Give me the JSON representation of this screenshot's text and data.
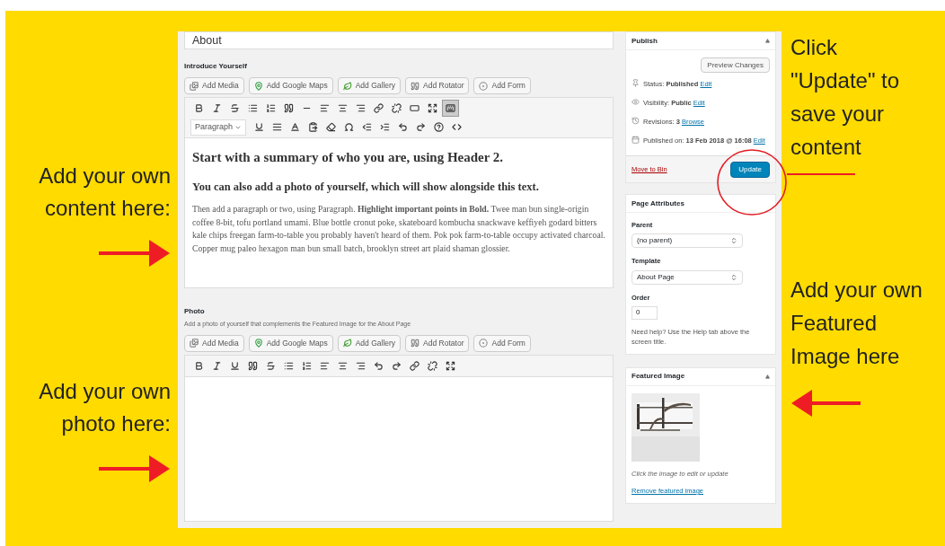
{
  "annotations_left": [
    {
      "text": "Add your own content here:"
    },
    {
      "text": "Add your own photo here:"
    }
  ],
  "annotations_right": [
    {
      "text": "Click \"Update\" to save your content",
      "kind": "line"
    },
    {
      "text": "Add your own Featured Image here",
      "kind": "arrow"
    }
  ],
  "title_field": {
    "value": "About"
  },
  "sections": [
    {
      "label": "Introduce Yourself",
      "media_buttons": [
        {
          "kind": "media",
          "label": "Add Media"
        },
        {
          "kind": "maps",
          "label": "Add Google Maps"
        },
        {
          "kind": "gallery",
          "label": "Add Gallery"
        },
        {
          "kind": "rotator",
          "label": "Add Rotator"
        },
        {
          "kind": "form",
          "label": "Add Form"
        }
      ],
      "toolbar_rows": [
        [
          {
            "kind": "bold",
            "selected": false
          },
          {
            "kind": "italic",
            "selected": false
          },
          {
            "kind": "strike",
            "selected": false
          },
          {
            "kind": "ul",
            "selected": false
          },
          {
            "kind": "ol",
            "selected": false
          },
          {
            "kind": "quote",
            "selected": false
          },
          {
            "kind": "hr",
            "selected": false
          },
          {
            "kind": "left",
            "selected": false
          },
          {
            "kind": "center",
            "selected": false
          },
          {
            "kind": "right",
            "selected": false
          },
          {
            "kind": "link",
            "selected": false
          },
          {
            "kind": "unlink",
            "selected": false
          },
          {
            "kind": "more",
            "selected": false
          },
          {
            "kind": "fullscreen",
            "selected": false
          },
          {
            "kind": "toggle",
            "selected": true
          }
        ],
        [
          {
            "kind": "format",
            "value": "Paragraph"
          },
          {
            "kind": "underline",
            "selected": false
          },
          {
            "kind": "justify",
            "selected": false
          },
          {
            "kind": "color",
            "selected": false
          },
          {
            "kind": "paste",
            "selected": false
          },
          {
            "kind": "clear",
            "selected": false
          },
          {
            "kind": "omega",
            "selected": false
          },
          {
            "kind": "outdent",
            "selected": false
          },
          {
            "kind": "indent",
            "selected": false
          },
          {
            "kind": "undo",
            "selected": false
          },
          {
            "kind": "redo",
            "selected": false
          },
          {
            "kind": "help",
            "selected": false
          },
          {
            "kind": "code",
            "selected": false
          }
        ]
      ],
      "content": [
        {
          "kind": "h2",
          "text": "Start with a summary of who you are, using Header 2."
        },
        {
          "kind": "h3",
          "text": "You can also add a photo of yourself, which will show alongside this text."
        },
        {
          "kind": "p",
          "text": "Then add a paragraph or two, using Paragraph. **Highlight important points in Bold.**  Twee man bun single-origin coffee 8-bit, tofu portland umami. Blue bottle cronut poke, skateboard kombucha snackwave keffiyeh godard bitters kale chips freegan farm-to-table you probably haven't heard of them. Pok pok farm-to-table occupy activated charcoal. Copper mug paleo hexagon man bun small batch, brooklyn street art plaid shaman glossier."
        }
      ]
    },
    {
      "label": "Photo",
      "description": "Add a photo of yourself that complements the Featured Image for the About Page",
      "media_buttons": [
        {
          "kind": "media",
          "label": "Add Media"
        },
        {
          "kind": "maps",
          "label": "Add Google Maps"
        },
        {
          "kind": "gallery",
          "label": "Add Gallery"
        },
        {
          "kind": "rotator",
          "label": "Add Rotator"
        },
        {
          "kind": "form",
          "label": "Add Form"
        }
      ],
      "toolbar_rows": [
        [
          {
            "kind": "bold",
            "selected": false
          },
          {
            "kind": "italic",
            "selected": false
          },
          {
            "kind": "underline",
            "selected": false
          },
          {
            "kind": "quote",
            "selected": false
          },
          {
            "kind": "strike",
            "selected": false
          },
          {
            "kind": "ul",
            "selected": false
          },
          {
            "kind": "ol",
            "selected": false
          },
          {
            "kind": "left",
            "selected": false
          },
          {
            "kind": "center",
            "selected": false
          },
          {
            "kind": "right",
            "selected": false
          },
          {
            "kind": "undo",
            "selected": false
          },
          {
            "kind": "redo",
            "selected": false
          },
          {
            "kind": "link",
            "selected": false
          },
          {
            "kind": "unlink",
            "selected": false
          },
          {
            "kind": "fullscreen",
            "selected": false
          }
        ]
      ]
    }
  ],
  "publish": {
    "title": "Publish",
    "preview_button": "Preview Changes",
    "rows": [
      {
        "kind": "status",
        "label": "Status:",
        "value": "Published",
        "link": "Edit"
      },
      {
        "kind": "visibility",
        "label": "Visibility:",
        "value": "Public",
        "link": "Edit"
      },
      {
        "kind": "revisions",
        "label": "Revisions:",
        "value": "3",
        "link": "Browse"
      },
      {
        "kind": "date",
        "label": "Published on:",
        "value": "13 Feb 2018 @ 16:08",
        "link": "Edit"
      }
    ],
    "trash_link": "Move to Bin",
    "update_button": "Update"
  },
  "page_attributes": {
    "title": "Page Attributes",
    "parent_label": "Parent",
    "parent_value": "(no parent)",
    "template_label": "Template",
    "template_value": "About Page",
    "order_label": "Order",
    "order_value": "0",
    "help": "Need help? Use the Help tab above the screen title."
  },
  "featured_image": {
    "title": "Featured Image",
    "hint": "Click the image to edit or update",
    "remove_link": "Remove featured image"
  }
}
